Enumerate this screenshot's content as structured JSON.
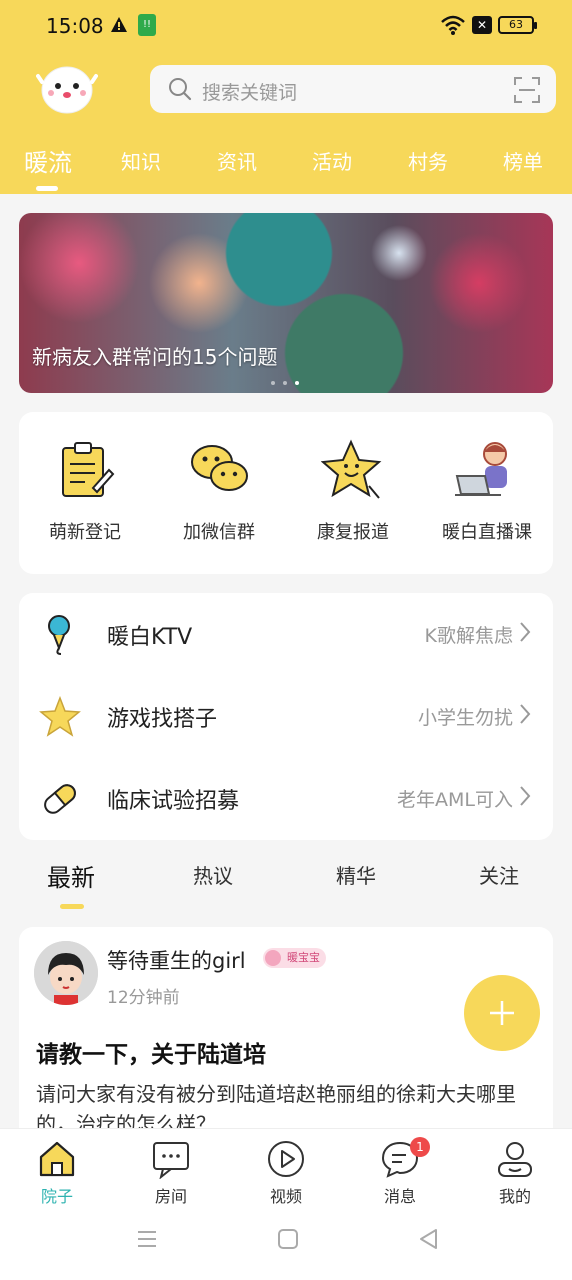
{
  "status_bar": {
    "time": "15:08",
    "battery": "63",
    "sim_badge": "!!"
  },
  "search": {
    "placeholder": "搜索关键词"
  },
  "top_tabs": [
    {
      "label": "暖流",
      "active": true
    },
    {
      "label": "知识"
    },
    {
      "label": "资讯"
    },
    {
      "label": "活动"
    },
    {
      "label": "村务"
    },
    {
      "label": "榜单"
    }
  ],
  "banner": {
    "title": "新病友入群常问的15个问题",
    "pages": 3,
    "current_page": 3
  },
  "quick_links": [
    {
      "label": "萌新登记",
      "icon": "clipboard-icon"
    },
    {
      "label": "加微信群",
      "icon": "wechat-icon"
    },
    {
      "label": "康复报道",
      "icon": "star-smile-icon"
    },
    {
      "label": "暖白直播课",
      "icon": "laptop-girl-icon"
    }
  ],
  "list_items": [
    {
      "title": "暖白KTV",
      "subtitle": "K歌解焦虑",
      "icon": "microphone-icon"
    },
    {
      "title": "游戏找搭子",
      "subtitle": "小学生勿扰",
      "icon": "star-icon"
    },
    {
      "title": "临床试验招募",
      "subtitle": "老年AML可入",
      "icon": "pill-icon"
    }
  ],
  "feed_tabs": [
    {
      "label": "最新",
      "active": true
    },
    {
      "label": "热议"
    },
    {
      "label": "精华"
    },
    {
      "label": "关注"
    }
  ],
  "post": {
    "author": "等待重生的girl",
    "badge": "暖宝宝",
    "time": "12分钟前",
    "title": "请教一下，关于陆道培",
    "body": "请问大家有没有被分到陆道培赵艳丽组的徐莉大夫哪里的，治疗的怎么样？"
  },
  "bottom_nav": [
    {
      "label": "院子",
      "icon": "home-icon",
      "active": true
    },
    {
      "label": "房间",
      "icon": "chat-room-icon"
    },
    {
      "label": "视频",
      "icon": "play-icon"
    },
    {
      "label": "消息",
      "icon": "message-icon",
      "badge": "1"
    },
    {
      "label": "我的",
      "icon": "profile-icon"
    }
  ],
  "colors": {
    "brand_yellow": "#f7d85a",
    "teal_active": "#2eb3b0",
    "badge_red": "#ee4a4a"
  }
}
